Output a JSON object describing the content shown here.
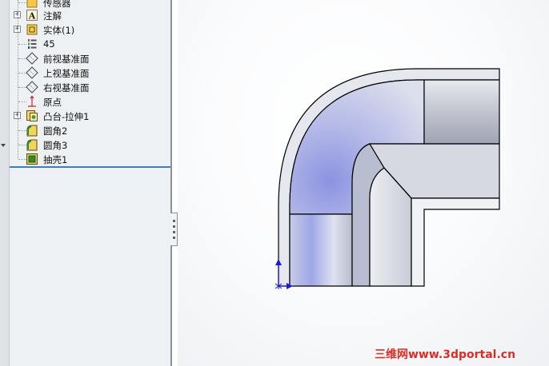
{
  "tree": {
    "items": [
      {
        "label": "传感器",
        "icon": "sensor-icon"
      },
      {
        "label": "注解",
        "icon": "annotation-icon"
      },
      {
        "label": "实体(1)",
        "icon": "solid-body-icon"
      },
      {
        "label": "45",
        "icon": "material-icon"
      },
      {
        "label": "前视基准面",
        "icon": "plane-icon"
      },
      {
        "label": "上视基准面",
        "icon": "plane-icon"
      },
      {
        "label": "右视基准面",
        "icon": "plane-icon"
      },
      {
        "label": "原点",
        "icon": "origin-icon"
      },
      {
        "label": "凸台-拉伸1",
        "icon": "extrude-icon"
      },
      {
        "label": "圆角2",
        "icon": "fillet-icon"
      },
      {
        "label": "圆角3",
        "icon": "fillet-icon"
      },
      {
        "label": "抽壳1",
        "icon": "shell-icon"
      }
    ],
    "expanders": [
      "+",
      "+",
      "+"
    ]
  },
  "watermark": "三维网www.3dportal.cn",
  "colors": {
    "selection_line": "#3a7fc4",
    "part_edge": "#000000",
    "part_face_light": "#e6e9ef",
    "part_face_blue": "#a7aee0",
    "triad_blue": "#1a1adc",
    "watermark": "#e8271f"
  }
}
